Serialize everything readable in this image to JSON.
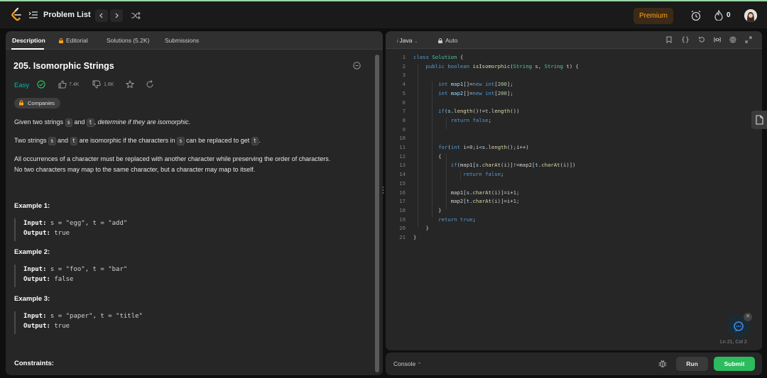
{
  "topbar": {
    "problem_list": "Problem List",
    "premium": "Premium",
    "streak_count": "0",
    "brand_color": "#ffa116"
  },
  "left_tabs": [
    {
      "label": "Description"
    },
    {
      "label": "Editorial"
    },
    {
      "label": "Solutions (5.2K)"
    },
    {
      "label": "Submissions"
    }
  ],
  "problem": {
    "title": "205. Isomorphic Strings",
    "difficulty": "Easy",
    "likes": "7.4K",
    "dislikes": "1.6K",
    "companies": "Companies",
    "p1_a": "Given two strings ",
    "p1_s": "s",
    "p1_b": " and ",
    "p1_t": "t",
    "p1_c": ", ",
    "p1_d": "determine if they are isomorphic",
    "p1_e": ".",
    "p2_a": "Two strings ",
    "p2_s": "s",
    "p2_b": " and ",
    "p2_t": "t",
    "p2_c": " are isomorphic if the characters in ",
    "p2_s2": "s",
    "p2_d": " can be replaced to get ",
    "p2_t2": "t",
    "p2_e": ".",
    "p3_l1": "All occurrences of a character must be replaced with another character while preserving the order of characters.",
    "p3_l2": "No two characters may map to the same character, but a character may map to itself."
  },
  "examples": [
    {
      "heading": "Example 1:",
      "input_label": "Input:",
      "input": " s = \"egg\", t = \"add\"",
      "output_label": "Output:",
      "output": " true"
    },
    {
      "heading": "Example 2:",
      "input_label": "Input:",
      "input": " s = \"foo\", t = \"bar\"",
      "output_label": "Output:",
      "output": " false"
    },
    {
      "heading": "Example 3:",
      "input_label": "Input:",
      "input": " s = \"paper\", t = \"title\"",
      "output_label": "Output:",
      "output": " true"
    }
  ],
  "constraints_heading": "Constraints:",
  "editor": {
    "language": "Java",
    "mode": "Auto",
    "line_numbers": [
      "1",
      "2",
      "3",
      "4",
      "5",
      "6",
      "7",
      "8",
      "9",
      "10",
      "11",
      "12",
      "13",
      "14",
      "15",
      "16",
      "17",
      "18",
      "19",
      "20",
      "21"
    ],
    "cursor": "Ln 21, Col 2"
  },
  "bottom": {
    "console": "Console",
    "run": "Run",
    "submit": "Submit",
    "submit_color": "#2cbb5d"
  }
}
